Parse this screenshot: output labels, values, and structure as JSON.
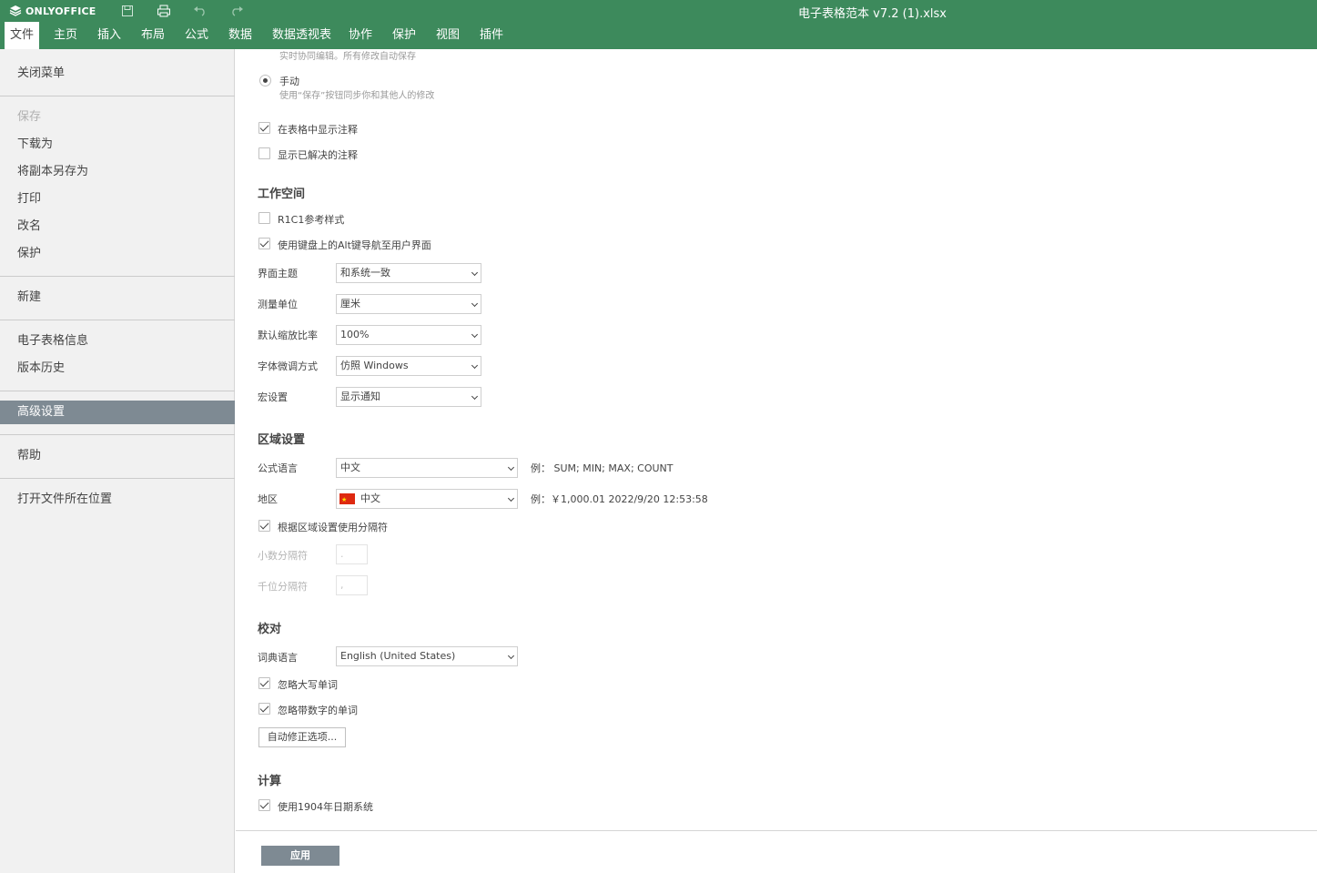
{
  "app": {
    "brand": "ONLYOFFICE",
    "doc_title": "电子表格范本 v7.2 (1).xlsx",
    "accent_color": "#3d8a5c"
  },
  "quick_access": {
    "icons": [
      "save-icon",
      "print-icon",
      "undo-icon",
      "redo-icon"
    ]
  },
  "menu": {
    "tabs": [
      "文件",
      "主页",
      "插入",
      "布局",
      "公式",
      "数据",
      "数据透视表",
      "协作",
      "保护",
      "视图",
      "插件"
    ],
    "active": "文件"
  },
  "left_panel": {
    "items": [
      "关闭菜单",
      "保存",
      "下载为",
      "将副本另存为",
      "打印",
      "改名",
      "保护",
      "新建",
      "电子表格信息",
      "版本历史",
      "高级设置",
      "帮助",
      "打开文件所在位置"
    ],
    "active": "高级设置",
    "disabled": "保存"
  },
  "settings": {
    "coauth": {
      "fast_desc": "实时协同编辑。所有修改自动保存",
      "manual_label": "手动",
      "manual_desc": "使用“保存”按钮同步你和其他人的修改"
    },
    "comments": {
      "show_in_sheet": "在表格中显示注释",
      "show_in_sheet_checked": true,
      "show_resolved": "显示已解决的注释",
      "show_resolved_checked": false
    },
    "workspace": {
      "title": "工作空间",
      "r1c1": "R1C1参考样式",
      "r1c1_checked": false,
      "alt_nav": "使用键盘上的Alt键导航至用户界面",
      "alt_nav_checked": true,
      "theme_label": "界面主题",
      "theme_value": "和系统一致",
      "unit_label": "测量单位",
      "unit_value": "厘米",
      "zoom_label": "默认缩放比率",
      "zoom_value": "100%",
      "hinting_label": "字体微调方式",
      "hinting_value": "仿照 Windows",
      "macro_label": "宏设置",
      "macro_value": "显示通知"
    },
    "regional": {
      "title": "区域设置",
      "formula_lang_label": "公式语言",
      "formula_lang_value": "中文",
      "formula_example": "例： SUM; MIN; MAX; COUNT",
      "region_label": "地区",
      "region_value": "中文",
      "region_example": "例：￥1,000.01 2022/9/20 12:53:58",
      "use_regional_sep": "根据区域设置使用分隔符",
      "use_regional_sep_checked": true,
      "decimal_label": "小数分隔符",
      "decimal_value": ".",
      "thousands_label": "千位分隔符",
      "thousands_value": ","
    },
    "proofing": {
      "title": "校对",
      "dict_label": "词典语言",
      "dict_value": "English (United States)",
      "ignore_upper": "忽略大写单词",
      "ignore_upper_checked": true,
      "ignore_numbers": "忽略带数字的单词",
      "ignore_numbers_checked": true,
      "autocorrect_button": "自动修正选项..."
    },
    "calculation": {
      "title": "计算",
      "date1904": "使用1904年日期系统",
      "date1904_checked": true
    },
    "apply_button": "应用"
  }
}
